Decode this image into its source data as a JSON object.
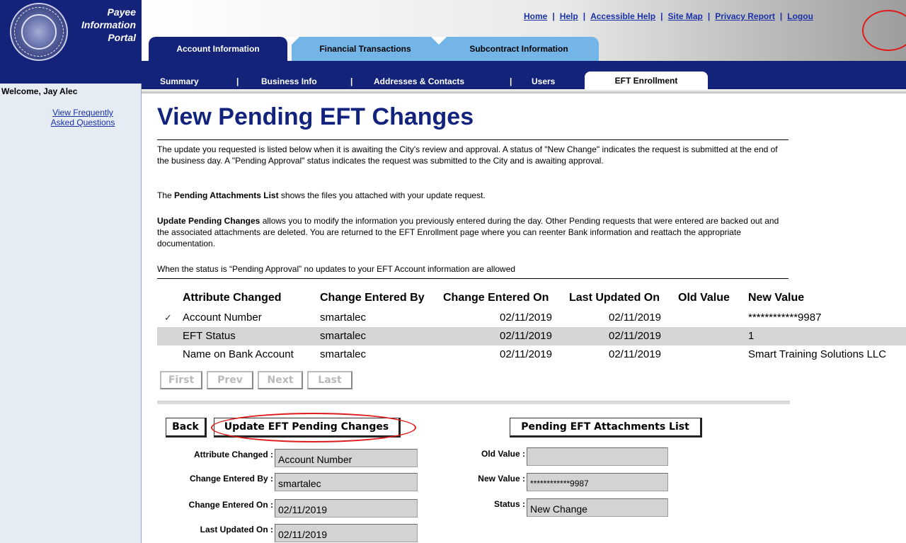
{
  "brand": {
    "line1": "Payee",
    "line2": "Information",
    "line3": "Portal"
  },
  "sidebar": {
    "welcome": "Welcome, Jay Alec",
    "faq_line1": "View Frequently",
    "faq_line2": "Asked Questions"
  },
  "toplinks": {
    "home": "Home",
    "help": "Help",
    "accessible_help": "Accessible Help",
    "site_map": "Site Map",
    "privacy_report": "Privacy Report",
    "logout": "Logou"
  },
  "tabs": {
    "account": "Account Information",
    "financial": "Financial Transactions",
    "subcontract": "Subcontract Information"
  },
  "subnav": {
    "summary": "Summary",
    "business_info": "Business Info",
    "addresses": "Addresses & Contacts",
    "users": "Users",
    "eft": "EFT Enrollment",
    "separator": "|"
  },
  "page": {
    "title": "View Pending EFT Changes",
    "para1": "The update you requested is listed below when it is awaiting the City's review and approval. A status of \"New Change\" indicates the request is submitted at the end of the business day. A \"Pending Approval\" status indicates the request was submitted to the City and is awaiting approval.",
    "para2_bold": "Pending Attachments List",
    "para2_pre": "The ",
    "para2_post": " shows the files you attached with your update request.",
    "para3_bold": "Update Pending Changes",
    "para3_post": " allows you to modify the information you previously entered during the day. Other Pending requests that were entered are backed out and the associated attachments are deleted. You are returned to the EFT Enrollment page where you can reenter Bank information and reattach the appropriate documentation.",
    "para4": "When the status is “Pending Approval” no updates to your EFT Account information are allowed"
  },
  "table": {
    "headers": [
      "Attribute Changed",
      "Change Entered By",
      "Change Entered On",
      "Last Updated On",
      "Old Value",
      "New Value"
    ],
    "selected_marker": "✓",
    "rows": [
      {
        "attribute": "Account Number",
        "entered_by": "smartalec",
        "entered_on": "02/11/2019",
        "updated_on": "02/11/2019",
        "old_value": "",
        "new_value": "************9987"
      },
      {
        "attribute": "EFT Status",
        "entered_by": "smartalec",
        "entered_on": "02/11/2019",
        "updated_on": "02/11/2019",
        "old_value": "",
        "new_value": "1"
      },
      {
        "attribute": "Name on Bank Account",
        "entered_by": "smartalec",
        "entered_on": "02/11/2019",
        "updated_on": "02/11/2019",
        "old_value": "",
        "new_value": "Smart Training Solutions LLC"
      }
    ]
  },
  "pager": {
    "first": "First",
    "prev": "Prev",
    "next": "Next",
    "last": "Last"
  },
  "buttons": {
    "back": "Back",
    "update": "Update EFT Pending Changes",
    "attachments": "Pending EFT Attachments List"
  },
  "form": {
    "attribute_label": "Attribute Changed :",
    "attribute_value": "Account Number",
    "entered_by_label": "Change Entered By :",
    "entered_by_value": "smartalec",
    "entered_on_label": "Change Entered On :",
    "entered_on_value": "02/11/2019",
    "updated_on_label": "Last Updated On :",
    "updated_on_value": "02/11/2019",
    "old_value_label": "Old Value :",
    "old_value_value": "",
    "new_value_label": "New Value :",
    "new_value_value": "************9987",
    "status_label": "Status :",
    "status_value": "New Change"
  },
  "colors": {
    "navy": "#13237a",
    "tab_light": "#74b5e8",
    "link": "#1a31a8",
    "highlight": "#e01b1b"
  }
}
